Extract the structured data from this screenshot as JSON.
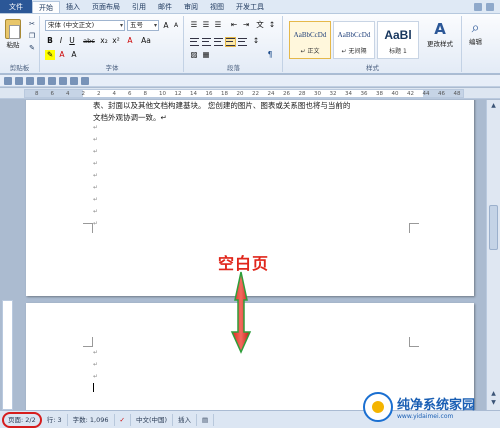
{
  "tabs": [
    "文件",
    "开始",
    "插入",
    "页面布局",
    "引用",
    "邮件",
    "审阅",
    "视图",
    "开发工具"
  ],
  "ribbon": {
    "clipboard": {
      "paste_label": "粘贴",
      "group_label": "剪贴板"
    },
    "font": {
      "font_name": "宋体 (中文正文)",
      "font_size": "五号",
      "group_label": "字体",
      "buttons": [
        "B",
        "I",
        "U",
        "abc",
        "x₂",
        "x²",
        "A",
        "Aa"
      ]
    },
    "paragraph": {
      "group_label": "段落"
    },
    "styles": {
      "group_label": "样式",
      "items": [
        {
          "sample": "AaBbCcDd",
          "name": "↵ 正文"
        },
        {
          "sample": "AaBbCcDd",
          "name": "↵ 无间隔"
        },
        {
          "sample": "AaBl",
          "name": "标题 1"
        }
      ],
      "change_styles": "更改样式",
      "edit": "编辑"
    }
  },
  "ruler_numbers": [
    "8",
    "6",
    "4",
    "2",
    "2",
    "4",
    "6",
    "8",
    "10",
    "12",
    "14",
    "16",
    "18",
    "20",
    "22",
    "24",
    "26",
    "28",
    "30",
    "32",
    "34",
    "36",
    "38",
    "40",
    "42",
    "44",
    "46",
    "48"
  ],
  "document": {
    "line1": "表、封面以及其他文档构建基块。 您创建的图片、图表或关系图也将与当前的",
    "line2": "文档外观协调一致。↵",
    "paragraph_mark": "↵"
  },
  "annotation": "空白页",
  "status": {
    "page": "页面: 2/2",
    "row": "行: 3",
    "words": "字数: 1,096",
    "language": "中文(中国)",
    "mode": "插入"
  },
  "watermark": {
    "main": "纯净系统家园",
    "sub": "www.yidaimei.com"
  },
  "colors": {
    "annotation": "#e0261b",
    "file_tab": "#2b5797",
    "status_highlight": "#d61d1d"
  }
}
